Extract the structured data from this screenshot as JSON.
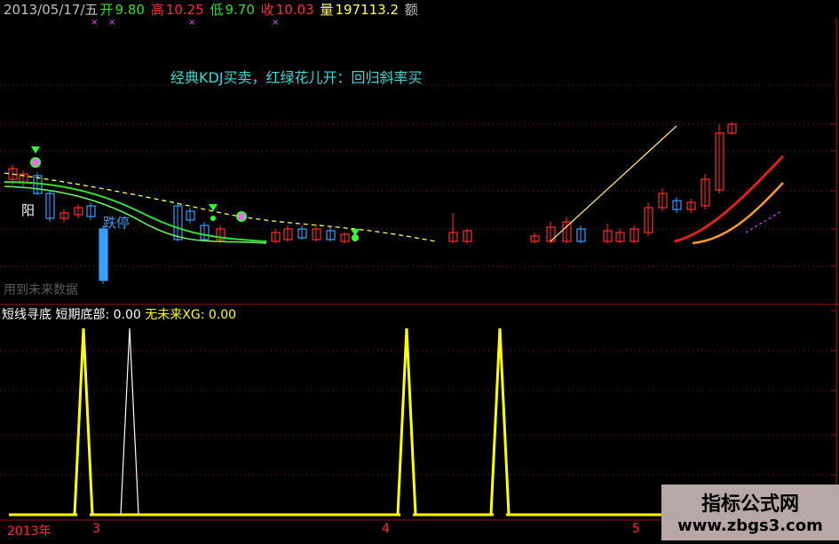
{
  "header": {
    "date": "2013/05/17/五",
    "open_label": "开",
    "open_value": "9.80",
    "high_label": "高",
    "high_value": "10.25",
    "low_label": "低",
    "low_value": "9.70",
    "close_label": "收",
    "close_value": "10.03",
    "volume_label": "量",
    "volume_value": "197113.2",
    "amount_label": "额"
  },
  "formula_title": "经典KDJ买卖，红绿花儿开：回归斜率买",
  "annotations": {
    "yang": "阳",
    "limit_down": "跌停",
    "future_data": "用到未来数据"
  },
  "lower_panel": {
    "name": "短线寻底",
    "param1_label": "短期底部:",
    "param1_value": "0.00",
    "param2_label": "无未来XG:",
    "param2_value": "0.00"
  },
  "footer": {
    "year": "2013年",
    "ticks": [
      "3",
      "4",
      "5"
    ]
  },
  "watermark": {
    "line1": "指标公式网",
    "line2": "www.zbgs3.com"
  },
  "colors": {
    "background": "#000000",
    "up": "#ff3030",
    "down": "#3aa0ff",
    "grid": "#8a1a1a",
    "ma_green": "#33dd33",
    "ma_dashed": "#ffff66",
    "signal_yellow": "#ffff00",
    "signal_white": "#ffffff"
  },
  "chart_data": [
    {
      "type": "line",
      "title": "",
      "series": [
        {
          "name": "",
          "x": [
            0,
            1,
            2,
            3,
            4,
            5,
            6,
            7,
            8,
            9,
            10,
            11,
            12,
            13,
            14,
            15,
            16,
            17,
            18,
            19,
            20,
            21,
            22,
            23,
            24,
            25,
            26,
            27,
            28,
            29,
            30,
            31,
            32,
            33,
            34,
            35,
            36,
            37,
            38,
            39,
            40,
            41,
            42,
            43,
            44,
            45,
            46,
            47,
            48,
            49,
            50,
            51,
            52,
            53,
            54,
            55,
            56,
            57,
            58,
            59,
            60,
            61,
            62,
            63,
            64,
            65,
            66,
            67,
            68,
            69,
            70,
            71,
            72,
            73,
            74,
            75,
            76,
            77,
            78,
            79,
            80,
            81,
            82,
            83,
            84,
            85,
            86,
            87,
            88,
            89,
            90,
            91,
            92,
            93,
            94,
            95,
            96,
            97,
            98,
            99,
            100,
            101,
            102,
            103,
            104,
            105,
            106,
            107,
            108,
            109,
            110,
            111,
            112,
            113,
            114,
            115,
            116,
            117,
            118,
            119
          ],
          "short_bottom": [
            0,
            0,
            0,
            0,
            0,
            0,
            0,
            0,
            0,
            0,
            0,
            0,
            1,
            0,
            0,
            0,
            0,
            0,
            0,
            0,
            0,
            0,
            0,
            0,
            0,
            0,
            0,
            0,
            0,
            0,
            0,
            0,
            0,
            0,
            0,
            0,
            0,
            0,
            0,
            0,
            0,
            0,
            0,
            0,
            0,
            0,
            0,
            0,
            0,
            0,
            0,
            0,
            0,
            0,
            0,
            0,
            0,
            0,
            0,
            0,
            0,
            0,
            0,
            0,
            1,
            0,
            0,
            0,
            0,
            0,
            0,
            0,
            0,
            0,
            0,
            0,
            0,
            0,
            0,
            1,
            0,
            0,
            0,
            0,
            0,
            0,
            0,
            0,
            0,
            0,
            0,
            0,
            0,
            0,
            0,
            0,
            0,
            0,
            0,
            0,
            0,
            0,
            0,
            0,
            0,
            0,
            0,
            0,
            0,
            0,
            0,
            0,
            0,
            0,
            0,
            0,
            0,
            0,
            0,
            0
          ]
        }
      ]
    }
  ]
}
